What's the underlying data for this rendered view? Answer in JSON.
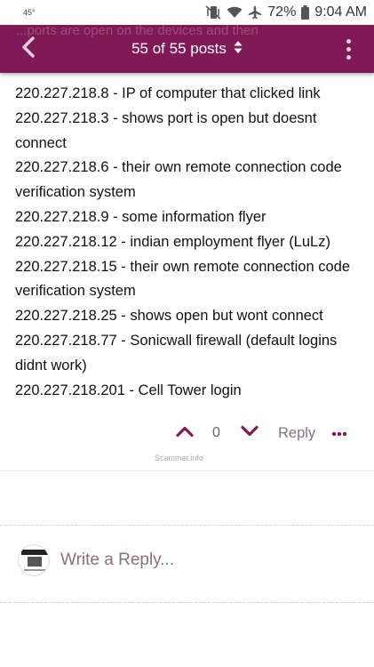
{
  "status": {
    "temperature": "45°",
    "battery": "72%",
    "time": "9:04 AM"
  },
  "topbar": {
    "ghost_text": "...ports are open on the devices and then",
    "counter": "55 of 55 posts"
  },
  "post": {
    "lines": [
      "220.227.218.8 - IP of computer that clicked link",
      "220.227.218.3 - shows port is open but doesnt connect",
      "220.227.218.6 - their own remote connection code verification system",
      "220.227.218.9 - some information flyer",
      "220.227.218.12 - indian employment flyer (LuLz)",
      "220.227.218.15 - their own remote connection code verification system",
      "220.227.218.25 - shows open but wont connect",
      "220.227.218.77 - Sonicwall firewall (default logins didnt work)",
      "220.227.218.201 - Cell Tower login"
    ]
  },
  "actions": {
    "vote_count": "0",
    "reply_label": "Reply"
  },
  "watermark": "Scammer.info",
  "composer": {
    "placeholder": "Write a Reply..."
  },
  "colors": {
    "brand": "#7f1a57",
    "muted_link": "#8a6f80"
  }
}
